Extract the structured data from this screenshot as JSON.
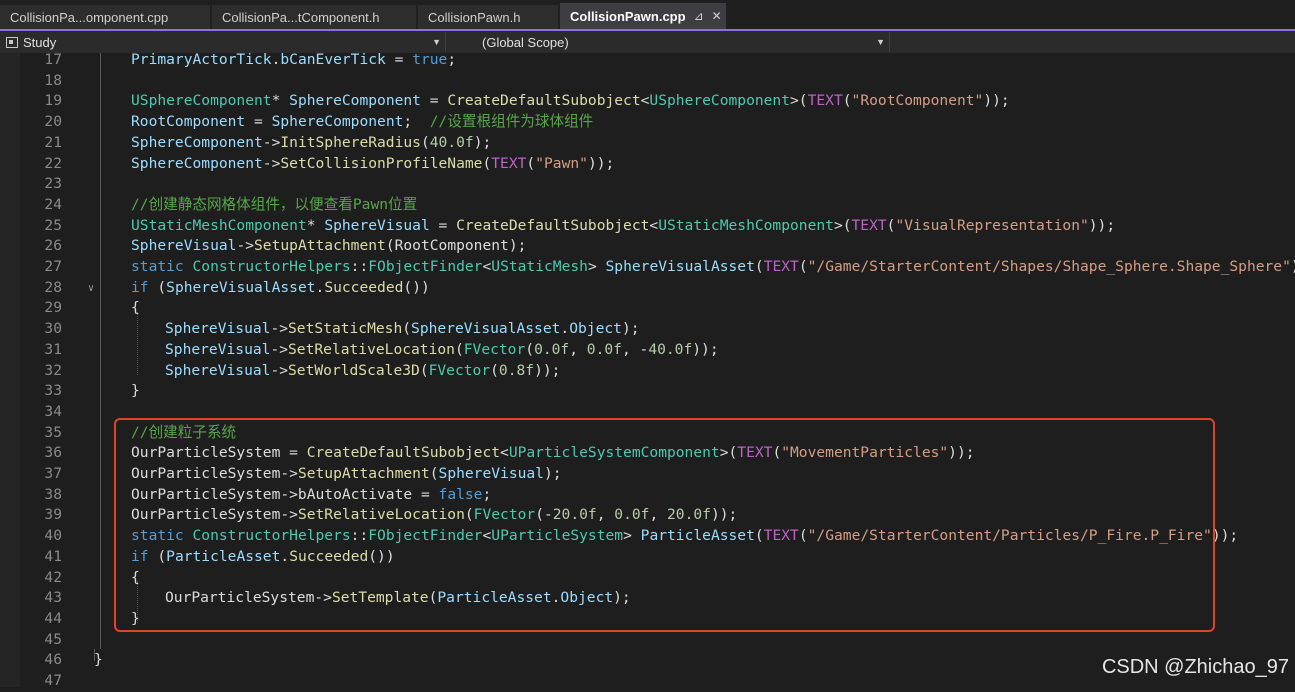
{
  "tabs": [
    {
      "label": "CollisionPa...omponent.cpp",
      "active": false
    },
    {
      "label": "CollisionPa...tComponent.h",
      "active": false
    },
    {
      "label": "CollisionPawn.h",
      "active": false
    },
    {
      "label": "CollisionPawn.cpp",
      "active": true
    }
  ],
  "tab_icons": {
    "pin": "⊿",
    "close": "✕"
  },
  "navbar": {
    "project": "Study",
    "scope": "(Global Scope)"
  },
  "watermark": "CSDN @Zhichao_97",
  "code_lines": [
    {
      "n": "17",
      "indent": 0,
      "tokens": [
        [
          "var",
          "PrimaryActorTick"
        ],
        [
          "p",
          "."
        ],
        [
          "var",
          "bCanEverTick"
        ],
        [
          "p",
          " = "
        ],
        [
          "kw",
          "true"
        ],
        [
          "p",
          ";"
        ]
      ]
    },
    {
      "n": "18",
      "indent": 0,
      "tokens": []
    },
    {
      "n": "19",
      "indent": 0,
      "tokens": [
        [
          "type",
          "USphereComponent"
        ],
        [
          "p",
          "* "
        ],
        [
          "var",
          "SphereComponent"
        ],
        [
          "p",
          " = "
        ],
        [
          "fn",
          "CreateDefaultSubobject"
        ],
        [
          "p",
          "<"
        ],
        [
          "type",
          "USphereComponent"
        ],
        [
          "p",
          ">("
        ],
        [
          "mac",
          "TEXT"
        ],
        [
          "p",
          "("
        ],
        [
          "str",
          "\"RootComponent\""
        ],
        [
          "p",
          "));"
        ]
      ]
    },
    {
      "n": "20",
      "indent": 0,
      "tokens": [
        [
          "var",
          "RootComponent"
        ],
        [
          "p",
          " = "
        ],
        [
          "var",
          "SphereComponent"
        ],
        [
          "p",
          ";  "
        ],
        [
          "cmt",
          "//设置根组件为球体组件"
        ]
      ]
    },
    {
      "n": "21",
      "indent": 0,
      "tokens": [
        [
          "var",
          "SphereComponent"
        ],
        [
          "p",
          "->"
        ],
        [
          "fn",
          "InitSphereRadius"
        ],
        [
          "p",
          "("
        ],
        [
          "num",
          "40.0f"
        ],
        [
          "p",
          ");"
        ]
      ]
    },
    {
      "n": "22",
      "indent": 0,
      "tokens": [
        [
          "var",
          "SphereComponent"
        ],
        [
          "p",
          "->"
        ],
        [
          "fn",
          "SetCollisionProfileName"
        ],
        [
          "p",
          "("
        ],
        [
          "mac",
          "TEXT"
        ],
        [
          "p",
          "("
        ],
        [
          "str",
          "\"Pawn\""
        ],
        [
          "p",
          "));"
        ]
      ]
    },
    {
      "n": "23",
      "indent": 0,
      "tokens": []
    },
    {
      "n": "24",
      "indent": 0,
      "tokens": [
        [
          "cmt",
          "//创建静态网格体组件，以便查看Pawn位置"
        ]
      ]
    },
    {
      "n": "25",
      "indent": 0,
      "tokens": [
        [
          "type",
          "UStaticMeshComponent"
        ],
        [
          "p",
          "* "
        ],
        [
          "var",
          "SphereVisual"
        ],
        [
          "p",
          " = "
        ],
        [
          "fn",
          "CreateDefaultSubobject"
        ],
        [
          "p",
          "<"
        ],
        [
          "type",
          "UStaticMeshComponent"
        ],
        [
          "p",
          ">("
        ],
        [
          "mac",
          "TEXT"
        ],
        [
          "p",
          "("
        ],
        [
          "str",
          "\"VisualRepresentation\""
        ],
        [
          "p",
          "));"
        ]
      ]
    },
    {
      "n": "26",
      "indent": 0,
      "tokens": [
        [
          "var",
          "SphereVisual"
        ],
        [
          "p",
          "->"
        ],
        [
          "fn",
          "SetupAttachment"
        ],
        [
          "p",
          "(RootComponent);"
        ]
      ]
    },
    {
      "n": "27",
      "indent": 0,
      "tokens": [
        [
          "kw",
          "static "
        ],
        [
          "type",
          "ConstructorHelpers"
        ],
        [
          "p",
          "::"
        ],
        [
          "type",
          "FObjectFinder"
        ],
        [
          "p",
          "<"
        ],
        [
          "type",
          "UStaticMesh"
        ],
        [
          "p",
          "> "
        ],
        [
          "var",
          "SphereVisualAsset"
        ],
        [
          "p",
          "("
        ],
        [
          "mac",
          "TEXT"
        ],
        [
          "p",
          "("
        ],
        [
          "str",
          "\"/Game/StarterContent/Shapes/Shape_Sphere.Shape_Sphere\""
        ],
        [
          "p",
          "));"
        ]
      ]
    },
    {
      "n": "28",
      "indent": 0,
      "tokens": [
        [
          "kw",
          "if"
        ],
        [
          "p",
          " ("
        ],
        [
          "var",
          "SphereVisualAsset"
        ],
        [
          "p",
          "."
        ],
        [
          "fn",
          "Succeeded"
        ],
        [
          "p",
          "())"
        ]
      ]
    },
    {
      "n": "29",
      "indent": 0,
      "tokens": [
        [
          "p",
          "{"
        ]
      ]
    },
    {
      "n": "30",
      "indent": 1,
      "tokens": [
        [
          "var",
          "SphereVisual"
        ],
        [
          "p",
          "->"
        ],
        [
          "fn",
          "SetStaticMesh"
        ],
        [
          "p",
          "("
        ],
        [
          "var",
          "SphereVisualAsset"
        ],
        [
          "p",
          "."
        ],
        [
          "var",
          "Object"
        ],
        [
          "p",
          ");"
        ]
      ]
    },
    {
      "n": "31",
      "indent": 1,
      "tokens": [
        [
          "var",
          "SphereVisual"
        ],
        [
          "p",
          "->"
        ],
        [
          "fn",
          "SetRelativeLocation"
        ],
        [
          "p",
          "("
        ],
        [
          "type",
          "FVector"
        ],
        [
          "p",
          "("
        ],
        [
          "num",
          "0.0f"
        ],
        [
          "p",
          ", "
        ],
        [
          "num",
          "0.0f"
        ],
        [
          "p",
          ", -"
        ],
        [
          "num",
          "40.0f"
        ],
        [
          "p",
          "));"
        ]
      ]
    },
    {
      "n": "32",
      "indent": 1,
      "tokens": [
        [
          "var",
          "SphereVisual"
        ],
        [
          "p",
          "->"
        ],
        [
          "fn",
          "SetWorldScale3D"
        ],
        [
          "p",
          "("
        ],
        [
          "type",
          "FVector"
        ],
        [
          "p",
          "("
        ],
        [
          "num",
          "0.8f"
        ],
        [
          "p",
          "));"
        ]
      ]
    },
    {
      "n": "33",
      "indent": 0,
      "tokens": [
        [
          "p",
          "}"
        ]
      ]
    },
    {
      "n": "34",
      "indent": 0,
      "tokens": []
    },
    {
      "n": "35",
      "indent": 0,
      "tokens": [
        [
          "cmt",
          "//创建粒子系统"
        ]
      ]
    },
    {
      "n": "36",
      "indent": 0,
      "tokens": [
        [
          "p",
          "OurParticleSystem = "
        ],
        [
          "fn",
          "CreateDefaultSubobject"
        ],
        [
          "p",
          "<"
        ],
        [
          "type",
          "UParticleSystemComponent"
        ],
        [
          "p",
          ">("
        ],
        [
          "mac",
          "TEXT"
        ],
        [
          "p",
          "("
        ],
        [
          "str",
          "\"MovementParticles\""
        ],
        [
          "p",
          "));"
        ]
      ]
    },
    {
      "n": "37",
      "indent": 0,
      "tokens": [
        [
          "p",
          "OurParticleSystem->"
        ],
        [
          "fn",
          "SetupAttachment"
        ],
        [
          "p",
          "("
        ],
        [
          "var",
          "SphereVisual"
        ],
        [
          "p",
          ");"
        ]
      ]
    },
    {
      "n": "38",
      "indent": 0,
      "tokens": [
        [
          "p",
          "OurParticleSystem->bAutoActivate = "
        ],
        [
          "kw",
          "false"
        ],
        [
          "p",
          ";"
        ]
      ]
    },
    {
      "n": "39",
      "indent": 0,
      "tokens": [
        [
          "p",
          "OurParticleSystem->"
        ],
        [
          "fn",
          "SetRelativeLocation"
        ],
        [
          "p",
          "("
        ],
        [
          "type",
          "FVector"
        ],
        [
          "p",
          "(-"
        ],
        [
          "num",
          "20.0f"
        ],
        [
          "p",
          ", "
        ],
        [
          "num",
          "0.0f"
        ],
        [
          "p",
          ", "
        ],
        [
          "num",
          "20.0f"
        ],
        [
          "p",
          "));"
        ]
      ]
    },
    {
      "n": "40",
      "indent": 0,
      "tokens": [
        [
          "kw",
          "static "
        ],
        [
          "type",
          "ConstructorHelpers"
        ],
        [
          "p",
          "::"
        ],
        [
          "type",
          "FObjectFinder"
        ],
        [
          "p",
          "<"
        ],
        [
          "type",
          "UParticleSystem"
        ],
        [
          "p",
          "> "
        ],
        [
          "var",
          "ParticleAsset"
        ],
        [
          "p",
          "("
        ],
        [
          "mac",
          "TEXT"
        ],
        [
          "p",
          "("
        ],
        [
          "str",
          "\"/Game/StarterContent/Particles/P_Fire.P_Fire\""
        ],
        [
          "p",
          "));"
        ]
      ]
    },
    {
      "n": "41",
      "indent": 0,
      "tokens": [
        [
          "kw",
          "if"
        ],
        [
          "p",
          " ("
        ],
        [
          "var",
          "ParticleAsset"
        ],
        [
          "p",
          "."
        ],
        [
          "fn",
          "Succeeded"
        ],
        [
          "p",
          "())"
        ]
      ]
    },
    {
      "n": "42",
      "indent": 0,
      "tokens": [
        [
          "p",
          "{"
        ]
      ]
    },
    {
      "n": "43",
      "indent": 1,
      "tokens": [
        [
          "p",
          "OurParticleSystem->"
        ],
        [
          "fn",
          "SetTemplate"
        ],
        [
          "p",
          "("
        ],
        [
          "var",
          "ParticleAsset"
        ],
        [
          "p",
          "."
        ],
        [
          "var",
          "Object"
        ],
        [
          "p",
          ");"
        ]
      ]
    },
    {
      "n": "44",
      "indent": 0,
      "tokens": [
        [
          "p",
          "}"
        ]
      ]
    },
    {
      "n": "45",
      "indent": 0,
      "tokens": []
    },
    {
      "n": "46",
      "indent": -1,
      "tokens": [
        [
          "p",
          "}"
        ]
      ]
    },
    {
      "n": "47",
      "indent": 0,
      "tokens": []
    }
  ]
}
